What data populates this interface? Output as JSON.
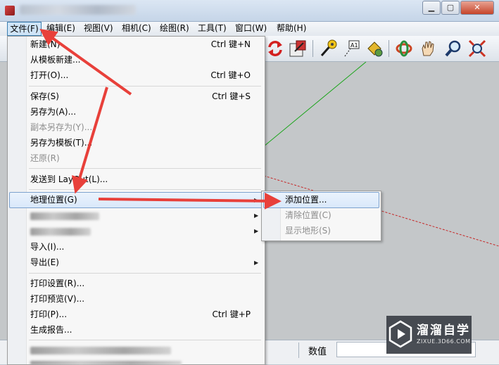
{
  "menubar": {
    "items": [
      "文件(F)",
      "编辑(E)",
      "视图(V)",
      "相机(C)",
      "绘图(R)",
      "工具(T)",
      "窗口(W)",
      "帮助(H)"
    ]
  },
  "toolbar": {
    "icons": [
      "rotate-refresh-icon",
      "scale-icon",
      "tape-measure-icon",
      "text-icon",
      "paint-bucket-icon",
      "orbit-icon",
      "pan-hand-icon",
      "zoom-icon",
      "zoom-extents-icon"
    ]
  },
  "file_menu": {
    "items": [
      {
        "label": "新建(N)",
        "shortcut": "Ctrl 键+N"
      },
      {
        "label": "从模板新建..."
      },
      {
        "label": "打开(O)...",
        "shortcut": "Ctrl 键+O"
      },
      {
        "label": "保存(S)",
        "shortcut": "Ctrl 键+S"
      },
      {
        "label": "另存为(A)..."
      },
      {
        "label": "副本另存为(Y)..."
      },
      {
        "label": "另存为模板(T)..."
      },
      {
        "label": "还原(R)"
      },
      {
        "label": "发送到 LayOut(L)..."
      },
      {
        "label": "地理位置(G)"
      },
      {
        "label": "导入(I)..."
      },
      {
        "label": "导出(E)"
      },
      {
        "label": "打印设置(R)..."
      },
      {
        "label": "打印预览(V)..."
      },
      {
        "label": "打印(P)...",
        "shortcut": "Ctrl 键+P"
      },
      {
        "label": "生成报告..."
      }
    ]
  },
  "submenu": {
    "items": [
      "添加位置...",
      "清除位置(C)",
      "显示地形(S)"
    ]
  },
  "statusbar": {
    "value_label": "数值"
  },
  "watermark": {
    "title": "溜溜自学",
    "subtitle": "ZIXUE.3D66.COM"
  },
  "colors": {
    "arrow": "#e8403a",
    "green_axis": "#1aa51a",
    "red_axis": "#c62828",
    "highlight": "#d9e8fa"
  }
}
